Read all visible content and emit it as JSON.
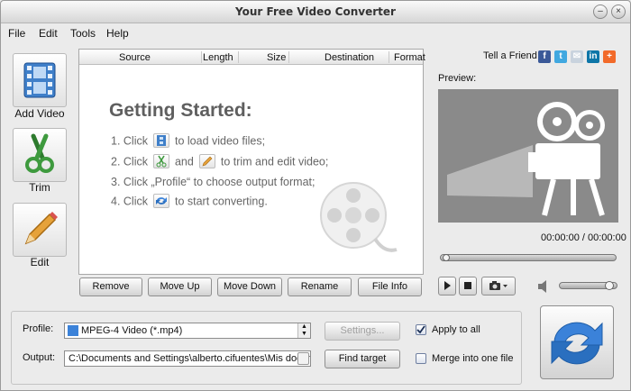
{
  "window": {
    "title": "Your Free Video Converter"
  },
  "menu": [
    "File",
    "Edit",
    "Tools",
    "Help"
  ],
  "left_tools": [
    {
      "label": "Add Video",
      "icon": "film-icon"
    },
    {
      "label": "Trim",
      "icon": "scissors-icon"
    },
    {
      "label": "Edit",
      "icon": "pencil-icon"
    }
  ],
  "file_list": {
    "columns": [
      "Source",
      "Length",
      "Size",
      "Destination",
      "Format"
    ],
    "getting_started": {
      "title": "Getting Started:",
      "step1_a": "1. Click",
      "step1_b": "to load video files;",
      "step2_a": "2. Click",
      "step2_b": "and",
      "step2_c": "to  trim and edit video;",
      "step3": "3. Click „Profile“ to choose output format;",
      "step4_a": "4. Click",
      "step4_b": "to start converting."
    }
  },
  "list_buttons": [
    "Remove",
    "Move Up",
    "Move Down",
    "Rename",
    "File Info"
  ],
  "bottom": {
    "profile_label": "Profile:",
    "profile_value": "MPEG-4 Video (*.mp4)",
    "settings_label": "Settings...",
    "apply_all_label": "Apply to all",
    "apply_all_checked": true,
    "output_label": "Output:",
    "output_value": "C:\\Documents and Settings\\alberto.cifuentes\\Mis documentos",
    "find_target_label": "Find target",
    "merge_label": "Merge into one file",
    "merge_checked": false
  },
  "right": {
    "tell_friend": "Tell a Friend",
    "preview_label": "Preview:",
    "time": "00:00:00 / 00:00:00",
    "seek_progress": 0,
    "volume_level": 0.85
  },
  "colors": {
    "accent": "#2a6fbf",
    "convert_blue": "#3b82d9"
  }
}
